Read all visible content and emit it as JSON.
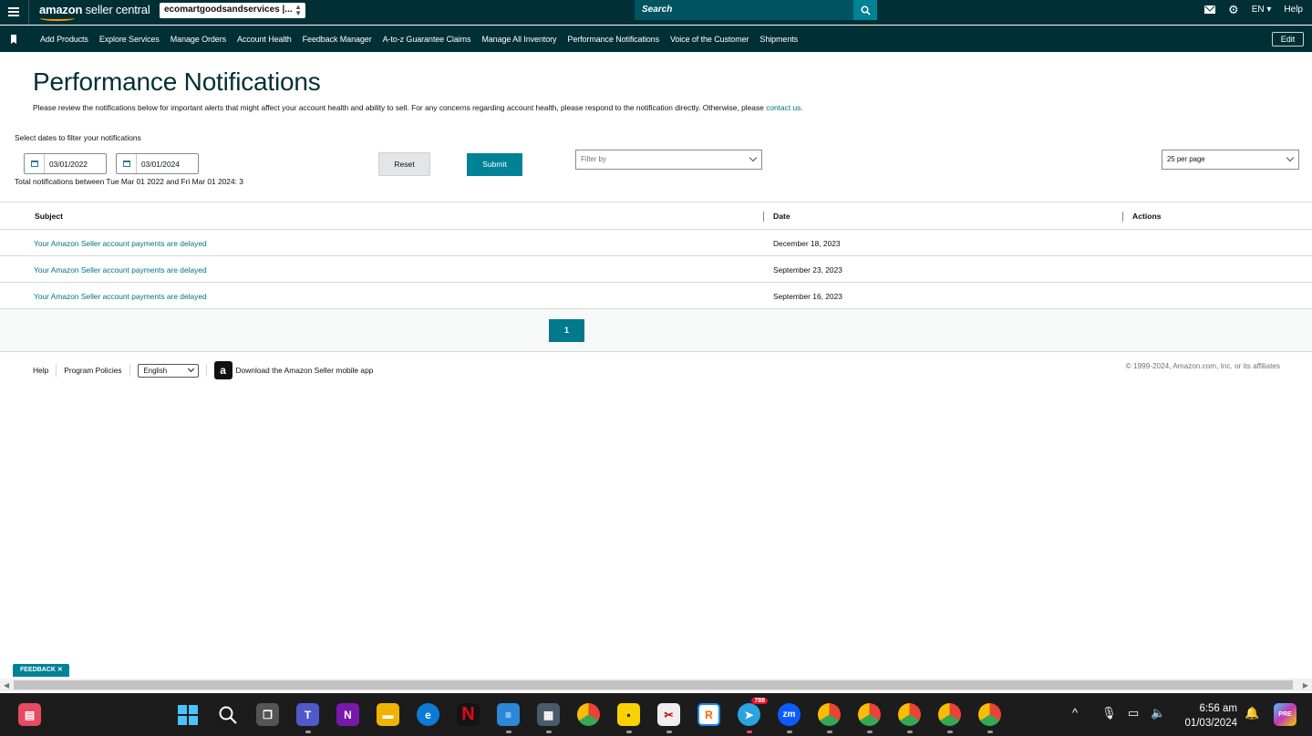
{
  "header": {
    "logo_text_bold": "amazon",
    "logo_text": "seller central",
    "account": "ecomartgoodsandservices |...",
    "search_placeholder": "Search",
    "language": "EN",
    "help": "Help"
  },
  "nav": {
    "items": [
      "Add Products",
      "Explore Services",
      "Manage Orders",
      "Account Health",
      "Feedback Manager",
      "A-to-z Guarantee Claims",
      "Manage All Inventory",
      "Performance Notifications",
      "Voice of the Customer",
      "Shipments"
    ],
    "edit_label": "Edit"
  },
  "page": {
    "title": "Performance Notifications",
    "description": "Please review the notifications below for important alerts that might affect your account health and ability to sell. For any concerns regarding account health, please respond to the notification directly. Otherwise, please",
    "contact_link": "contact us",
    "description_end": ".",
    "filter_label": "Select dates to filter your notifications",
    "start_date": "03/01/2022",
    "end_date": "03/01/2024",
    "reset_label": "Reset",
    "submit_label": "Submit",
    "filter_placeholder": "Filter by",
    "per_page": "25 per page",
    "total_text": "Total notifications between Tue Mar 01 2022 and Fri Mar 01 2024: 3"
  },
  "table": {
    "headers": [
      "Subject",
      "Date",
      "Actions"
    ],
    "rows": [
      {
        "subject": "Your Amazon Seller account payments are delayed",
        "date": "December 18, 2023"
      },
      {
        "subject": "Your Amazon Seller account payments are delayed",
        "date": "September 23, 2023"
      },
      {
        "subject": "Your Amazon Seller account payments are delayed",
        "date": "September 16, 2023"
      }
    ],
    "current_page": "1"
  },
  "footer": {
    "help": "Help",
    "program_policies": "Program Policies",
    "language": "English",
    "app_text": "Download the Amazon Seller mobile app",
    "copyright": "© 1999-2024, Amazon.com, Inc. or its affiliates"
  },
  "feedback": "FEEDBACK ✕",
  "taskbar": {
    "time": "6:56 am",
    "date": "01/03/2024",
    "telegram_badge": "788"
  },
  "colors": {
    "header_bg": "#002f36",
    "accent": "#008296",
    "link": "#007185"
  }
}
